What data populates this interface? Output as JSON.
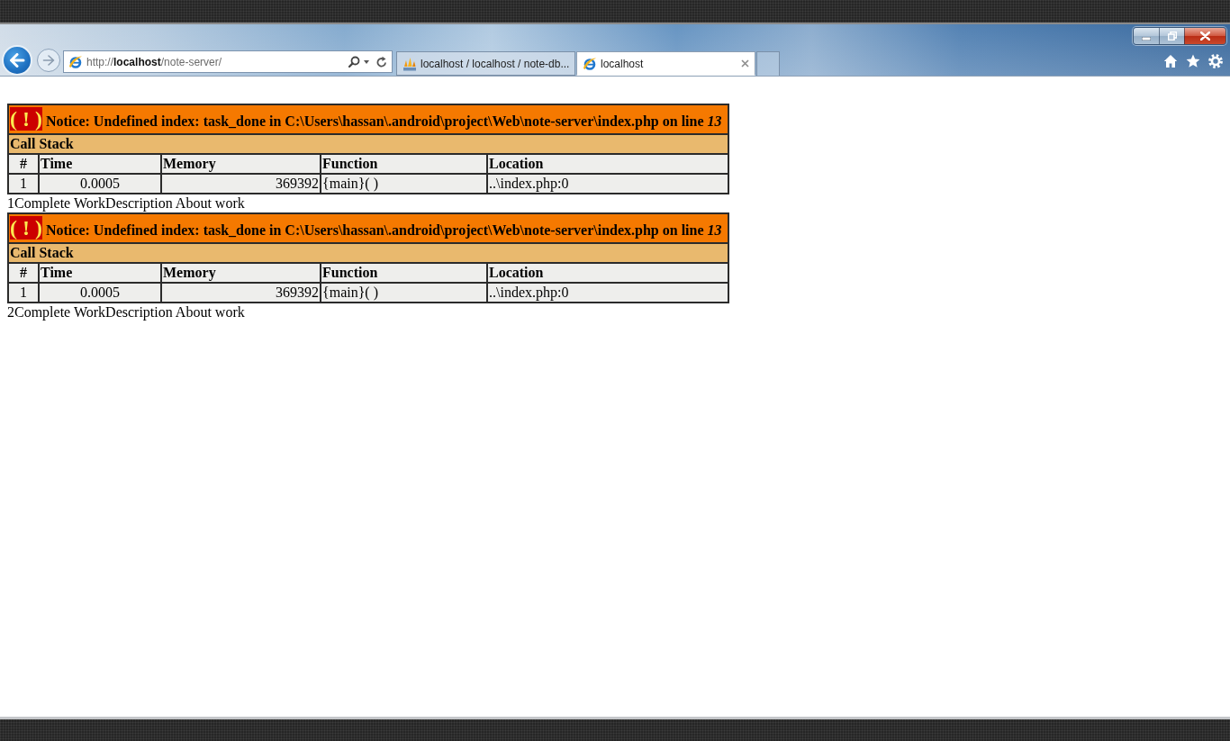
{
  "browser": {
    "address_bar": {
      "url": "http://**localhost**/note-server/"
    },
    "tabs": [
      {
        "kind": "database",
        "title": "localhost / localhost / note-db...",
        "selected": false
      },
      {
        "kind": "web",
        "title": "localhost",
        "selected": true
      }
    ]
  },
  "notices": [
    {
      "marker": "( ! )",
      "message": "Notice: Undefined index: task_done in C:\\Users\\hassan\\.android\\project\\Web\\note-server\\index.php on line *13*",
      "call_stack": {
        "title": "Call Stack",
        "columns": [
          "#",
          "Time",
          "Memory",
          "Function",
          "Location"
        ],
        "rows": [
          [
            "1",
            "0.0005",
            "369392",
            "{main}( )",
            "..\\index.php:0"
          ]
        ]
      },
      "output": "1Complete WorkDescription About work"
    },
    {
      "marker": "( ! )",
      "message": "Notice: Undefined index: task_done in C:\\Users\\hassan\\.android\\project\\Web\\note-server\\index.php on line *13*",
      "call_stack": {
        "title": "Call Stack",
        "columns": [
          "#",
          "Time",
          "Memory",
          "Function",
          "Location"
        ],
        "rows": [
          [
            "1",
            "0.0005",
            "369392",
            "{main}( )",
            "..\\index.php:0"
          ]
        ]
      },
      "output": "2Complete WorkDescription About work"
    }
  ]
}
